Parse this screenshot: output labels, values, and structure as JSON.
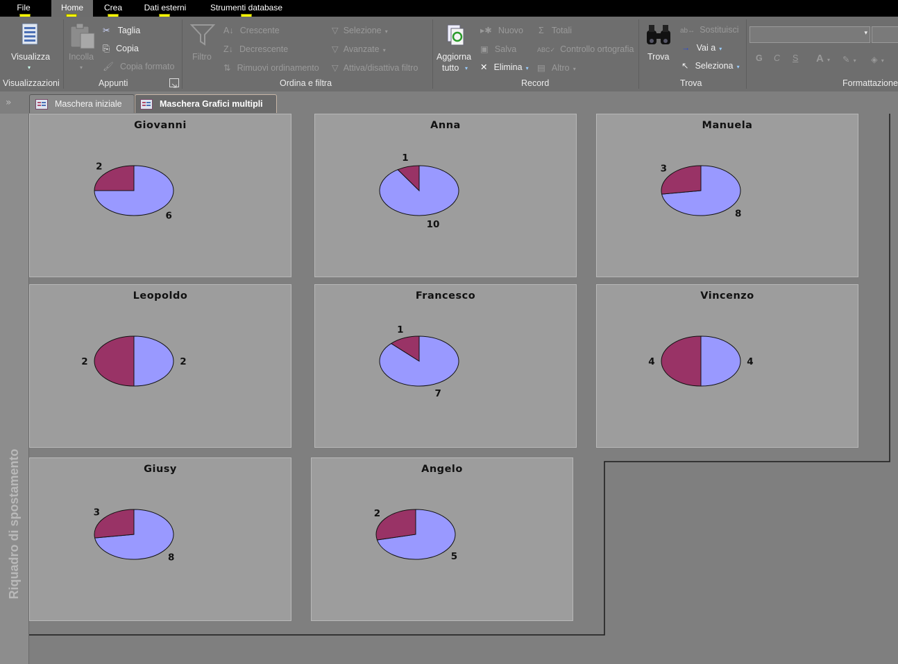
{
  "menu": {
    "items": [
      {
        "label": "File",
        "keytip": "F",
        "active": false
      },
      {
        "label": "Home",
        "keytip": "H",
        "active": true
      },
      {
        "label": "Crea",
        "keytip": "C",
        "active": false
      },
      {
        "label": "Dati esterni",
        "keytip": "R",
        "active": false
      },
      {
        "label": "Strumenti database",
        "keytip": "A",
        "active": false
      }
    ]
  },
  "ribbon": {
    "views": {
      "visualizza": "Visualizza",
      "group": "Visualizzazioni"
    },
    "clipboard": {
      "incolla": "Incolla",
      "taglia": "Taglia",
      "copia": "Copia",
      "copia_formato": "Copia formato",
      "group": "Appunti"
    },
    "sort": {
      "filtro": "Filtro",
      "crescente": "Crescente",
      "decrescente": "Decrescente",
      "rimuovi": "Rimuovi ordinamento",
      "selezione": "Selezione",
      "avanzate": "Avanzate",
      "attiva": "Attiva/disattiva filtro",
      "group": "Ordina e filtra"
    },
    "records": {
      "aggiorna": "Aggiorna",
      "tutto": "tutto",
      "nuovo": "Nuovo",
      "salva": "Salva",
      "elimina": "Elimina",
      "totali": "Totali",
      "controllo": "Controllo ortografia",
      "altro": "Altro",
      "group": "Record"
    },
    "find": {
      "trova": "Trova",
      "sostituisci": "Sostituisci",
      "vai": "Vai a",
      "seleziona": "Seleziona",
      "group": "Trova"
    },
    "format": {
      "group": "Formattazione",
      "bold": "G",
      "italic": "C",
      "underline": "S",
      "font_color": "A",
      "font_value": "",
      "size_value": ""
    }
  },
  "tabs": [
    {
      "label": "Maschera iniziale",
      "active": false
    },
    {
      "label": "Maschera Grafici multipli",
      "active": true
    }
  ],
  "nav_pane": {
    "title": "Riquadro di spostamento"
  },
  "colors": {
    "slice_a": "#9999ff",
    "slice_b": "#993366"
  },
  "people": [
    {
      "name": "Giovanni",
      "a": 6,
      "b": 2
    },
    {
      "name": "Anna",
      "a": 10,
      "b": 1
    },
    {
      "name": "Manuela",
      "a": 8,
      "b": 3
    },
    {
      "name": "Leopoldo",
      "a": 2,
      "b": 2
    },
    {
      "name": "Francesco",
      "a": 7,
      "b": 1
    },
    {
      "name": "Vincenzo",
      "a": 4,
      "b": 4
    },
    {
      "name": "Giusy",
      "a": 8,
      "b": 3
    },
    {
      "name": "Angelo",
      "a": 5,
      "b": 2
    }
  ]
}
